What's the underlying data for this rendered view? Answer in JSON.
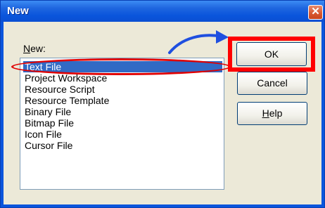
{
  "window": {
    "title": "New",
    "close_glyph": "✕"
  },
  "list": {
    "label": "New:",
    "selected_index": 0,
    "items": [
      "Text File",
      "Project Workspace",
      "Resource Script",
      "Resource Template",
      "Binary File",
      "Bitmap File",
      "Icon File",
      "Cursor File"
    ]
  },
  "buttons": {
    "ok": "OK",
    "cancel": "Cancel",
    "help_mnemonic": "H",
    "help_rest": "elp"
  },
  "annotations": {
    "highlight_color": "#ff0000",
    "arrow_color": "#1f4fe0"
  },
  "colors": {
    "title_bar": "#0a55dc",
    "selection": "#316ac5"
  }
}
